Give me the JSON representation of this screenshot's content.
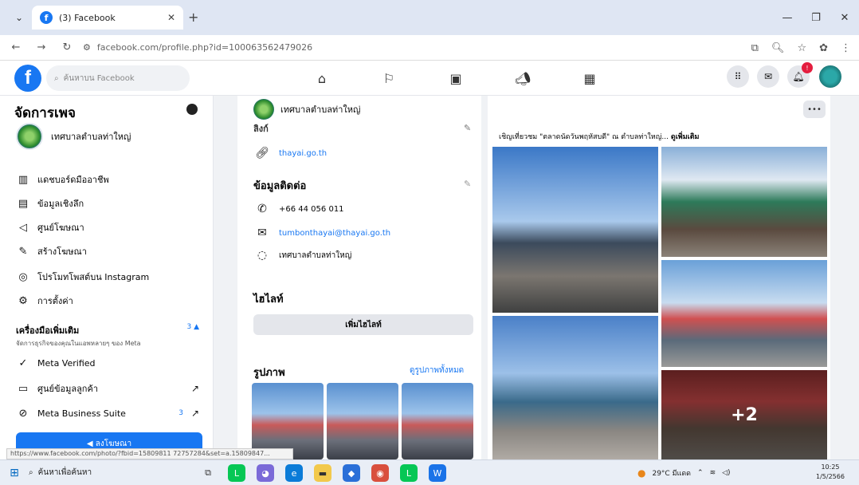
{
  "browser": {
    "tab_title": "(3) Facebook",
    "url": "facebook.com/profile.php?id=100063562479026",
    "status_url": "https://www.facebook.com/photo/?fbid=15809811 72757284&set=a.15809847..."
  },
  "fb": {
    "logo": "f",
    "search_placeholder": "ค้นหาบน Facebook",
    "notification_count": "!"
  },
  "sidebar": {
    "title": "จัดการเพจ",
    "page_name": "เทศบาลตำบลท่าใหญ่",
    "items": [
      {
        "label": "แดชบอร์ดมืออาชีพ",
        "icon": "dashboard-icon"
      },
      {
        "label": "ข้อมูลเชิงลึก",
        "icon": "insights-icon"
      },
      {
        "label": "ศูนย์โฆษณา",
        "icon": "megaphone-icon"
      },
      {
        "label": "สร้างโฆษณา",
        "icon": "pencil-icon"
      },
      {
        "label": "โปรโมทโพสต์บน Instagram",
        "icon": "instagram-icon"
      },
      {
        "label": "การตั้งค่า",
        "icon": "gear-icon"
      }
    ],
    "tools_title": "เครื่องมือเพิ่มเติม",
    "tools_subtitle": "จัดการธุรกิจของคุณในแอพหลายๆ ของ Meta",
    "tools_count": "3",
    "tools_items": [
      {
        "label": "Meta Verified",
        "icon": "verified-icon"
      },
      {
        "label": "ศูนย์ข้อมูลลูกค้า",
        "icon": "contact-card-icon"
      },
      {
        "label": "Meta Business Suite",
        "icon": "meta-business-icon",
        "count": "3"
      }
    ],
    "cta_label": "◀ ลงโฆษณา"
  },
  "middle": {
    "page_name": "เทศบาลตำบลท่าใหญ่",
    "cut_heading": "ลิงก์",
    "website": "thayai.go.th",
    "contact_title": "ข้อมูลติดต่อ",
    "phone": "+66 44 056 011",
    "email": "tumbonthayai@thayai.go.th",
    "messenger": "เทศบาลตำบลท่าใหญ่",
    "highlights_title": "ไฮไลท์",
    "highlights_button": "เพิ่มไฮไลท์",
    "photos_title": "รูปภาพ",
    "see_all": "ดูรูปภาพทั้งหมด"
  },
  "post": {
    "caption": "เชิญเที่ยวชม \"ตลาดนัดวันพฤหัสบดี\" ณ ตำบลท่าใหญ่...",
    "see_more": "ดูเพิ่มเติม",
    "more_photos": "+2"
  },
  "taskbar": {
    "search": "ค้นหาเพื่อค้นหา",
    "weather": "29°C มีแดด",
    "time": "10:25",
    "date": "1/5/2566"
  }
}
